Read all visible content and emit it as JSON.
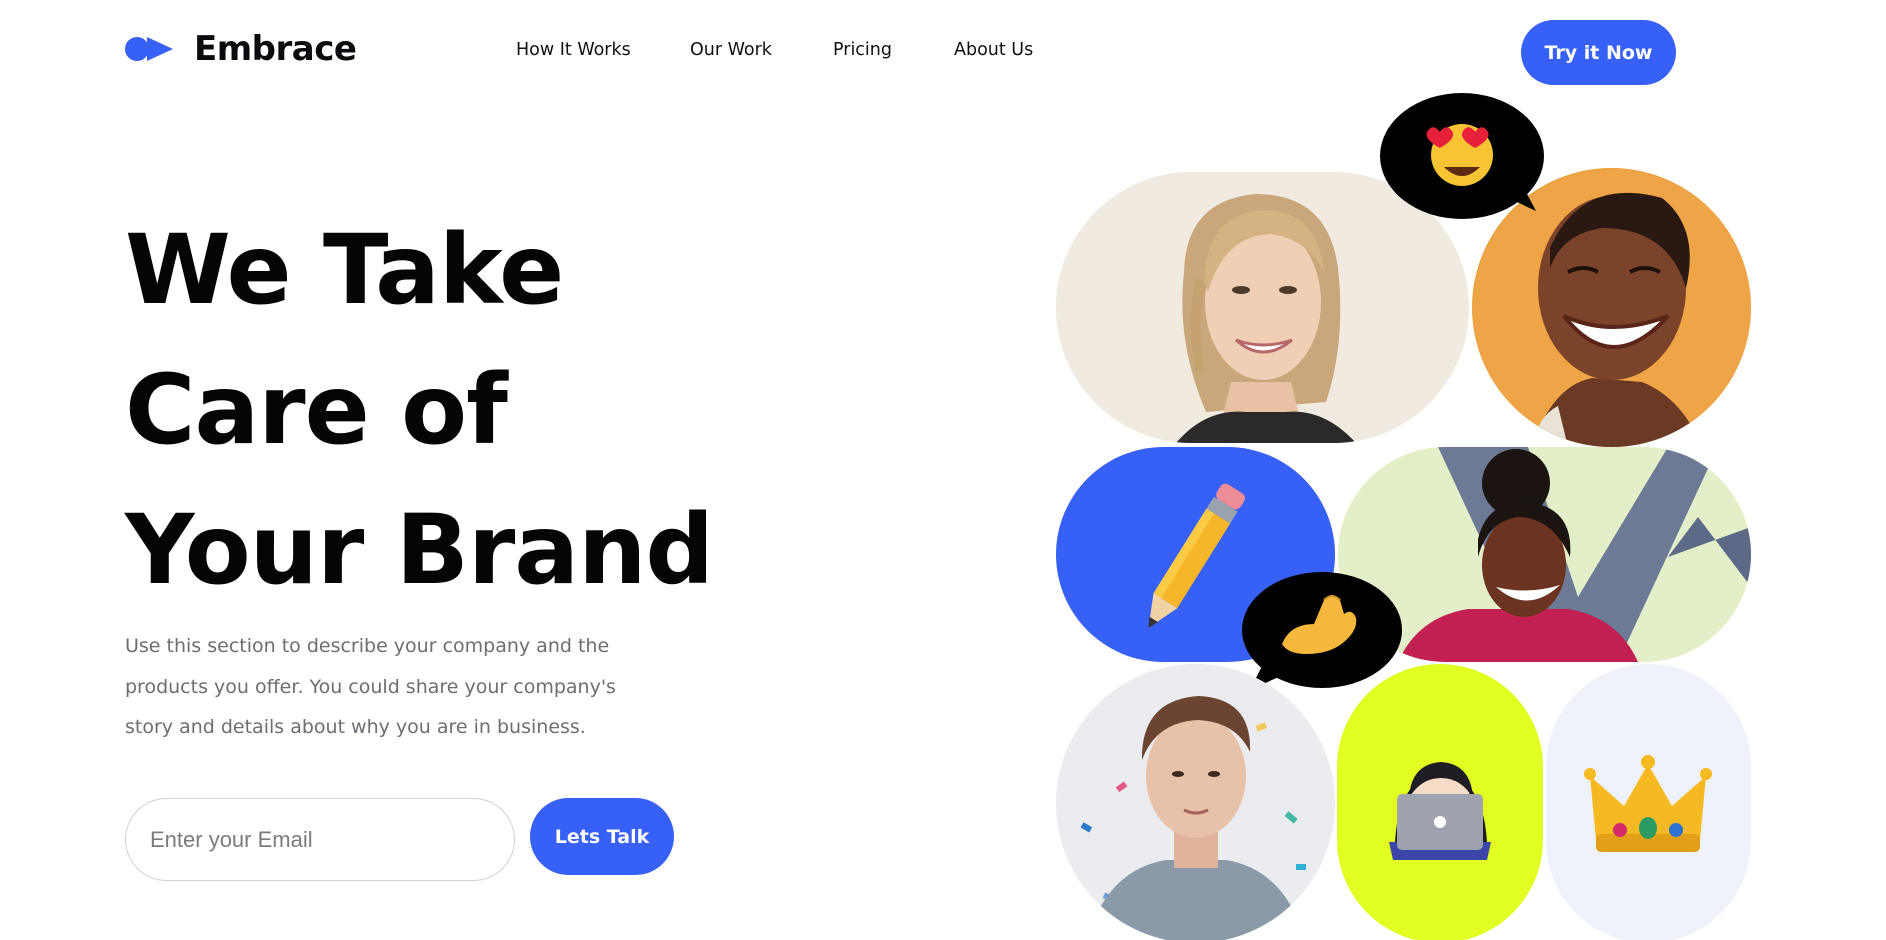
{
  "header": {
    "logo_text": "Embrace",
    "nav": [
      "How It Works",
      "Our Work",
      "Pricing",
      "About Us"
    ],
    "cta_label": "Try it Now"
  },
  "hero": {
    "headline_lines": [
      "We Take",
      "Care of",
      "Your Brand"
    ],
    "description": "Use this section to describe your company and the products you offer. You could share your company's story and details about why you are in business.",
    "email_placeholder": "Enter your Email",
    "cta_label": "Lets Talk"
  },
  "colors": {
    "accent": "#3760f6",
    "lime": "#e2ff22",
    "pale": "#f0f2fb",
    "bubble": "#000000"
  },
  "collage": {
    "images": [
      "smiling-blonde-woman-photo",
      "laughing-woman-orange-background-photo",
      "pencil-emoji",
      "laughing-girl-graffiti-wall-photo",
      "young-man-confetti-photo",
      "woman-technologist-emoji",
      "crown-emoji"
    ],
    "bubble_icons": [
      "heart-eyes-emoji",
      "pinched-fingers-emoji"
    ]
  }
}
